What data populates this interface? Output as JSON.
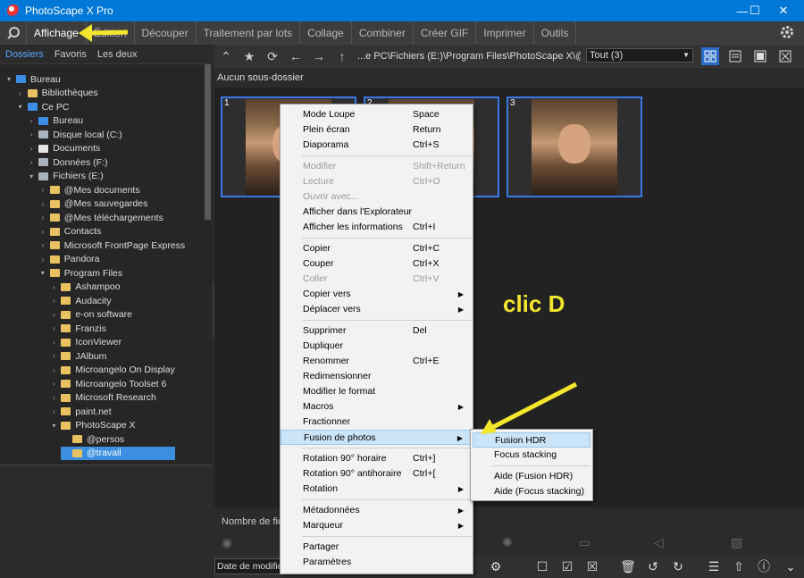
{
  "window": {
    "title": "PhotoScape X Pro",
    "minimize": "—",
    "maximize": "☐",
    "close": "✕"
  },
  "menu": {
    "items": [
      "Affichage",
      "Édition",
      "Découper",
      "Traitement par lots",
      "Collage",
      "Combiner",
      "Créer GIF",
      "Imprimer",
      "Outils"
    ],
    "active_index": 0
  },
  "left_tabs": [
    "Dossiers",
    "Favoris",
    "Les deux"
  ],
  "tree": [
    {
      "label": "Bureau",
      "indent": 0,
      "icon": "monitor",
      "twist": "▾"
    },
    {
      "label": "Bibliothèques",
      "indent": 1,
      "icon": "folder",
      "twist": "›"
    },
    {
      "label": "Ce PC",
      "indent": 1,
      "icon": "pc",
      "twist": "▾"
    },
    {
      "label": "Bureau",
      "indent": 2,
      "icon": "monitor",
      "twist": "›"
    },
    {
      "label": "Disque local (C:)",
      "indent": 2,
      "icon": "drive",
      "twist": "›"
    },
    {
      "label": "Documents",
      "indent": 2,
      "icon": "doc",
      "twist": "›"
    },
    {
      "label": "Données (F:)",
      "indent": 2,
      "icon": "drive",
      "twist": "›"
    },
    {
      "label": "Fichiers (E:)",
      "indent": 2,
      "icon": "drive",
      "twist": "▾"
    },
    {
      "label": "@Mes documents",
      "indent": 3,
      "icon": "folder",
      "twist": "›"
    },
    {
      "label": "@Mes sauvegardes",
      "indent": 3,
      "icon": "folder",
      "twist": "›"
    },
    {
      "label": "@Mes téléchargements",
      "indent": 3,
      "icon": "folder",
      "twist": "›"
    },
    {
      "label": "Contacts",
      "indent": 3,
      "icon": "folder",
      "twist": "›"
    },
    {
      "label": "Microsoft FrontPage Express",
      "indent": 3,
      "icon": "folder",
      "twist": "›"
    },
    {
      "label": "Pandora",
      "indent": 3,
      "icon": "folder",
      "twist": "›"
    },
    {
      "label": "Program Files",
      "indent": 3,
      "icon": "folder",
      "twist": "▾"
    },
    {
      "label": "Ashampoo",
      "indent": 4,
      "icon": "folder",
      "twist": "›"
    },
    {
      "label": "Audacity",
      "indent": 4,
      "icon": "folder",
      "twist": "›"
    },
    {
      "label": "e-on software",
      "indent": 4,
      "icon": "folder",
      "twist": "›"
    },
    {
      "label": "Franzis",
      "indent": 4,
      "icon": "folder",
      "twist": "›"
    },
    {
      "label": "IconViewer",
      "indent": 4,
      "icon": "folder",
      "twist": "›"
    },
    {
      "label": "JAlbum",
      "indent": 4,
      "icon": "folder",
      "twist": "›"
    },
    {
      "label": "Microangelo On Display",
      "indent": 4,
      "icon": "folder",
      "twist": "›"
    },
    {
      "label": "Microangelo Toolset 6",
      "indent": 4,
      "icon": "folder",
      "twist": "›"
    },
    {
      "label": "Microsoft Research",
      "indent": 4,
      "icon": "folder",
      "twist": "›"
    },
    {
      "label": "paint.net",
      "indent": 4,
      "icon": "folder",
      "twist": "›"
    },
    {
      "label": "PhotoScape X",
      "indent": 4,
      "icon": "folder",
      "twist": "▾"
    },
    {
      "label": "@persos",
      "indent": 5,
      "icon": "folder",
      "twist": ""
    },
    {
      "label": "@travail",
      "indent": 5,
      "icon": "folder",
      "twist": "",
      "selected": true
    }
  ],
  "toolbar": {
    "path": "...e PC\\Fichiers (E:)\\Program Files\\PhotoScape X\\@travail",
    "filter": "Tout (3)"
  },
  "subfolder_label": "Aucun sous-dossier",
  "thumbnails": [
    "1",
    "2",
    "3"
  ],
  "annotation": "clic D",
  "bottom": {
    "name_label": "Nombre de fich",
    "sort_label": "Date de modifica"
  },
  "context_menu": [
    {
      "label": "Mode Loupe",
      "shortcut": "Space"
    },
    {
      "label": "Plein écran",
      "shortcut": "Return"
    },
    {
      "label": "Diaporama",
      "shortcut": "Ctrl+S"
    },
    {
      "sep": true
    },
    {
      "label": "Modifier",
      "shortcut": "Shift+Return",
      "disabled": true
    },
    {
      "label": "Lecture",
      "shortcut": "Ctrl+O",
      "disabled": true
    },
    {
      "label": "Ouvrir avec...",
      "disabled": true
    },
    {
      "label": "Afficher dans l'Explorateur"
    },
    {
      "label": "Afficher les informations",
      "shortcut": "Ctrl+I"
    },
    {
      "sep": true
    },
    {
      "label": "Copier",
      "shortcut": "Ctrl+C"
    },
    {
      "label": "Couper",
      "shortcut": "Ctrl+X"
    },
    {
      "label": "Coller",
      "shortcut": "Ctrl+V",
      "disabled": true
    },
    {
      "label": "Copier vers",
      "submenu": true
    },
    {
      "label": "Déplacer vers",
      "submenu": true
    },
    {
      "sep": true
    },
    {
      "label": "Supprimer",
      "shortcut": "Del"
    },
    {
      "label": "Dupliquer"
    },
    {
      "label": "Renommer",
      "shortcut": "Ctrl+E"
    },
    {
      "label": "Redimensionner"
    },
    {
      "label": "Modifier le format"
    },
    {
      "label": "Macros",
      "submenu": true
    },
    {
      "label": "Fractionner"
    },
    {
      "label": "Fusion de photos",
      "submenu": true,
      "highlighted": true
    },
    {
      "sep": true
    },
    {
      "label": "Rotation 90° horaire",
      "shortcut": "Ctrl+]"
    },
    {
      "label": "Rotation 90° antihoraire",
      "shortcut": "Ctrl+["
    },
    {
      "label": "Rotation",
      "submenu": true
    },
    {
      "sep": true
    },
    {
      "label": "Métadonnées",
      "submenu": true
    },
    {
      "label": "Marqueur",
      "submenu": true
    },
    {
      "sep": true
    },
    {
      "label": "Partager"
    },
    {
      "label": "Paramètres"
    }
  ],
  "submenu": [
    {
      "label": "Fusion HDR",
      "highlighted": true
    },
    {
      "label": "Focus stacking"
    },
    {
      "sep": true
    },
    {
      "label": "Aide (Fusion HDR)"
    },
    {
      "label": "Aide (Focus stacking)"
    }
  ],
  "colors": {
    "accent": "#3b78e7",
    "titlebar": "#0078d7",
    "annotation": "#f3e62c",
    "highlight": "#cce4f7"
  }
}
